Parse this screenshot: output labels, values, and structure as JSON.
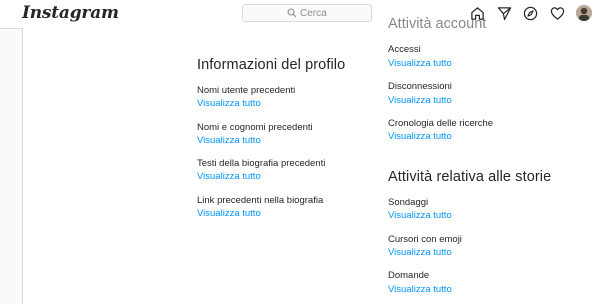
{
  "header": {
    "logo_text": "Instagram",
    "search": {
      "placeholder": "Cerca"
    },
    "icons": [
      "home-icon",
      "direct-icon",
      "explore-icon",
      "heart-icon",
      "avatar"
    ]
  },
  "left_column": {
    "title": "Informazioni del profilo",
    "items": [
      {
        "label": "Nomi utente precedenti",
        "link": "Visualizza tutto"
      },
      {
        "label": "Nomi e cognomi precedenti",
        "link": "Visualizza tutto"
      },
      {
        "label": "Testi della biografia precedenti",
        "link": "Visualizza tutto"
      },
      {
        "label": "Link precedenti nella biografia",
        "link": "Visualizza tutto"
      }
    ]
  },
  "right_column": {
    "cut_title": "Attività account",
    "account_items": [
      {
        "label": "Accessi",
        "link": "Visualizza tutto"
      },
      {
        "label": "Disconnessioni",
        "link": "Visualizza tutto"
      },
      {
        "label": "Cronologia delle ricerche",
        "link": "Visualizza tutto"
      }
    ],
    "stories_title": "Attività relativa alle storie",
    "stories_items": [
      {
        "label": "Sondaggi",
        "link": "Visualizza tutto"
      },
      {
        "label": "Cursori con emoji",
        "link": "Visualizza tutto"
      },
      {
        "label": "Domande",
        "link": "Visualizza tutto"
      }
    ]
  },
  "colors": {
    "link": "#0095f6",
    "text": "#262626",
    "border": "#dbdbdb",
    "background": "#fafafa"
  }
}
